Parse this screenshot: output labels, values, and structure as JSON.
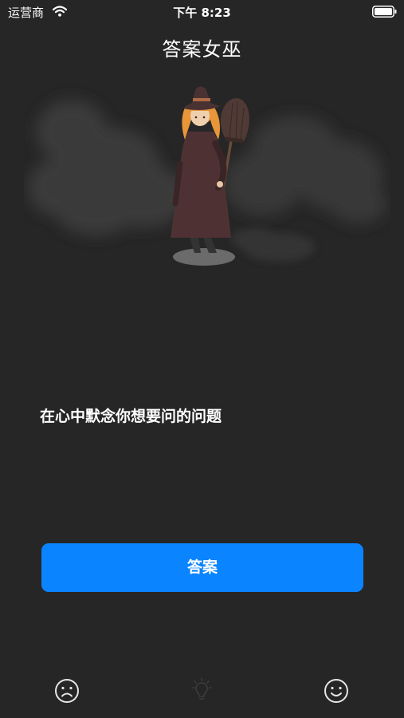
{
  "status_bar": {
    "carrier": "运营商",
    "time": "下午 8:23"
  },
  "nav": {
    "title": "答案女巫"
  },
  "main": {
    "prompt": "在心中默念你想要问的问题",
    "answer_button_label": "答案"
  },
  "tab_bar": {
    "items": [
      {
        "icon": "sad-face-icon",
        "active": false
      },
      {
        "icon": "lightbulb-icon",
        "active": false
      },
      {
        "icon": "happy-face-icon",
        "active": false
      }
    ]
  },
  "colors": {
    "background": "#262626",
    "accent": "#0a84ff",
    "text": "#ffffff",
    "inactive_icon": "#3c3c3c"
  }
}
